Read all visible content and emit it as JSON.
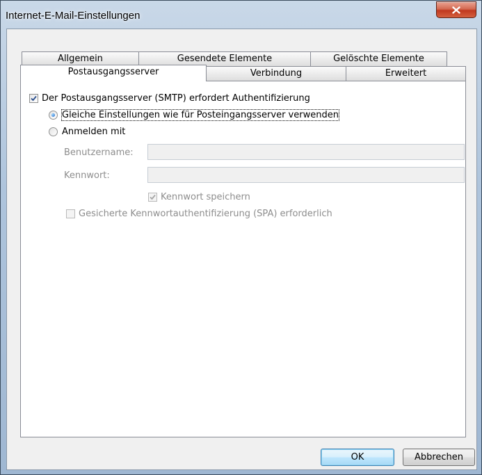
{
  "window": {
    "title": "Internet-E-Mail-Einstellungen"
  },
  "tabs": {
    "row1": [
      "Allgemein",
      "Gesendete Elemente",
      "Gelöschte Elemente"
    ],
    "row2": [
      "Postausgangsserver",
      "Verbindung",
      "Erweitert"
    ],
    "active": "Postausgangsserver"
  },
  "smtp_auth": {
    "label": "Der Postausgangsserver (SMTP) erfordert Authentifizierung",
    "checked": true
  },
  "radio_same_settings": {
    "label": "Gleiche Einstellungen wie für Posteingangsserver verwenden",
    "selected": true
  },
  "radio_login_with": {
    "label": "Anmelden mit",
    "selected": false
  },
  "username": {
    "label": "Benutzername:",
    "value": ""
  },
  "password": {
    "label": "Kennwort:",
    "value": ""
  },
  "save_password": {
    "label": "Kennwort speichern",
    "checked": true,
    "enabled": false
  },
  "spa": {
    "label": "Gesicherte Kennwortauthentifizierung (SPA) erforderlich",
    "checked": false,
    "enabled": false
  },
  "buttons": {
    "ok": "OK",
    "cancel": "Abbrechen"
  }
}
